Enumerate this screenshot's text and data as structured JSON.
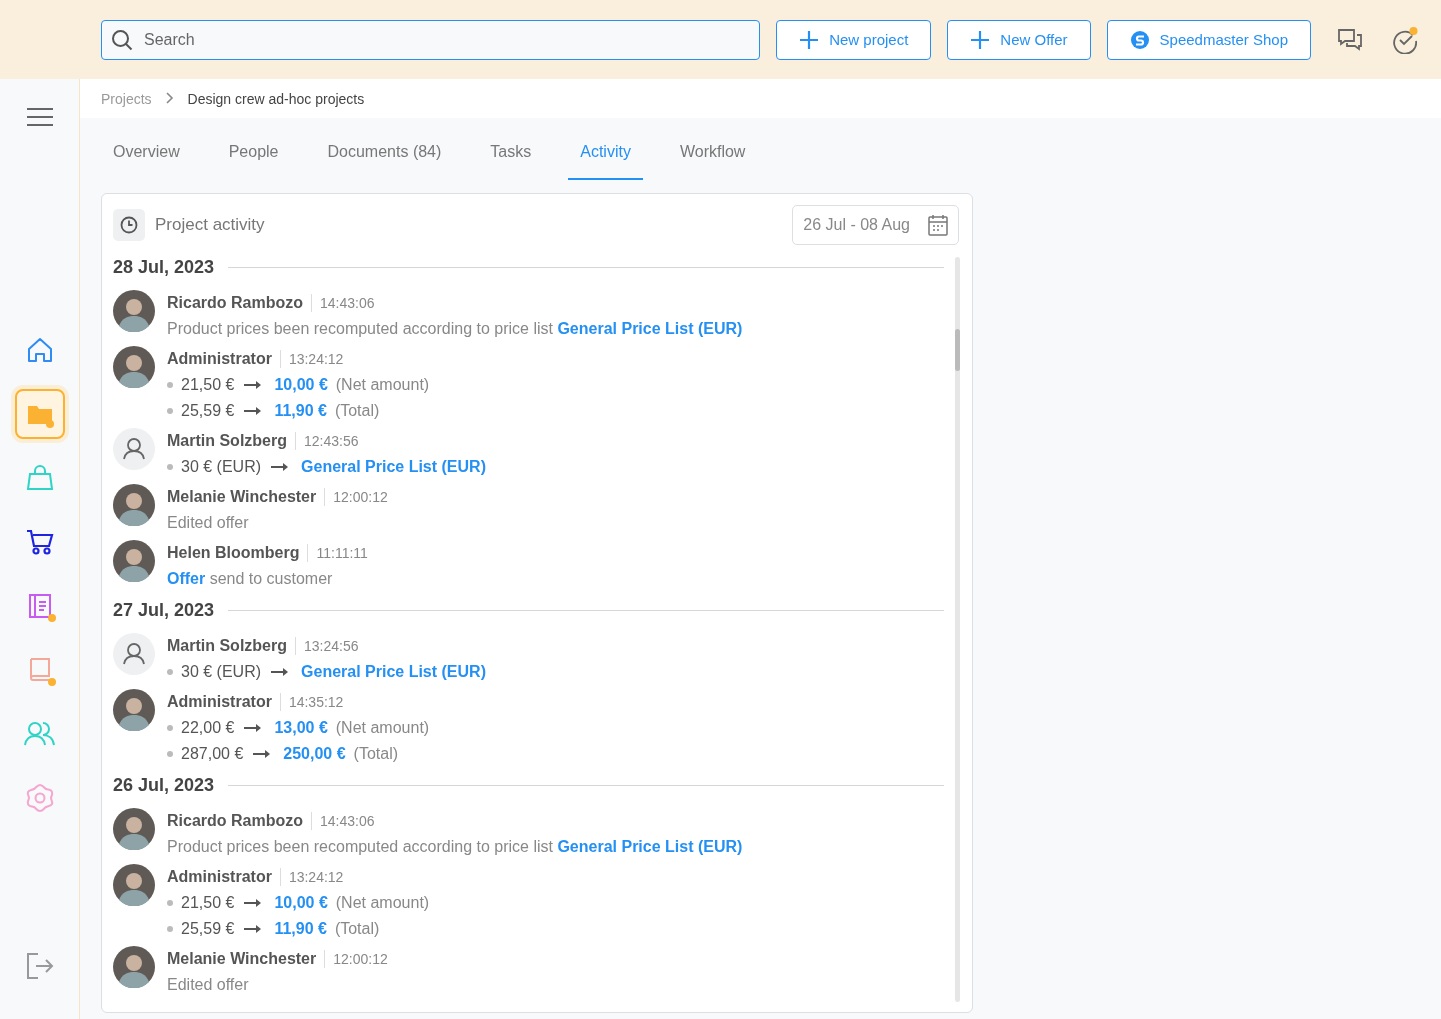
{
  "topbar": {
    "search": {
      "placeholder": "Search"
    },
    "buttons": [
      {
        "label": "New project",
        "kind": "plus"
      },
      {
        "label": "New Offer",
        "kind": "plus"
      },
      {
        "label": "Speedmaster Shop",
        "kind": "shop"
      }
    ],
    "notification_dot": true
  },
  "sidebar": {
    "items": [
      {
        "selected": false,
        "badge": false,
        "color": "#2f8cf5"
      },
      {
        "selected": true,
        "badge": true,
        "color": "#fbb131"
      },
      {
        "selected": false,
        "badge": false,
        "color": "#2fd4c6"
      },
      {
        "selected": false,
        "badge": false,
        "color": "#1f24e0"
      },
      {
        "selected": false,
        "badge": true,
        "color": "#c95cf0"
      },
      {
        "selected": false,
        "badge": true,
        "color": "#f3a89a"
      },
      {
        "selected": false,
        "badge": false,
        "color": "#2fd4c6"
      },
      {
        "selected": false,
        "badge": false,
        "color": "#f6a6cf"
      }
    ]
  },
  "breadcrumb": [
    "Projects",
    "Design crew ad-hoc projects"
  ],
  "tabs": [
    {
      "label": "Overview",
      "selected": false
    },
    {
      "label": "People",
      "selected": false
    },
    {
      "label": "Documents (84)",
      "selected": false
    },
    {
      "label": "Tasks",
      "selected": false
    },
    {
      "label": "Activity",
      "selected": true
    },
    {
      "label": "Workflow",
      "selected": false
    }
  ],
  "activity": {
    "title": "Project activity",
    "date_range": "26 Jul - 08 Aug",
    "days": [
      {
        "date": "28 Jul, 2023",
        "entries": [
          {
            "name": "Ricardo Rambozo",
            "time": "14:43:06",
            "kind": "photo",
            "lines": [
              {
                "kind": "message",
                "parts": [
                  {
                    "text": "Product prices been recomputed according to price list ",
                    "link": false
                  },
                  {
                    "text": "General Price List (EUR)",
                    "link": true
                  }
                ]
              }
            ]
          },
          {
            "name": "Administrator",
            "time": "13:24:12",
            "kind": "photo",
            "lines": [
              {
                "kind": "change",
                "from": "21,50 €",
                "to": "10,00 €",
                "note": "(Net amount)"
              },
              {
                "kind": "change",
                "from": "25,59 €",
                "to": "11,90 €",
                "note": "(Total)"
              }
            ]
          },
          {
            "name": "Martin Solzberg",
            "time": "12:43:56",
            "kind": "placeholder",
            "lines": [
              {
                "kind": "change",
                "from": "30 € (EUR)",
                "to": "General Price List (EUR)"
              }
            ]
          },
          {
            "name": "Melanie Winchester",
            "time": "12:00:12",
            "kind": "photo",
            "lines": [
              {
                "kind": "message",
                "parts": [
                  {
                    "text": "Edited offer",
                    "link": false
                  }
                ]
              }
            ]
          },
          {
            "name": "Helen Bloomberg",
            "time": "11:11:11",
            "kind": "photo",
            "lines": [
              {
                "kind": "message",
                "parts": [
                  {
                    "text": "Offer",
                    "link": true
                  },
                  {
                    "text": " send to customer",
                    "link": false
                  }
                ]
              }
            ]
          }
        ]
      },
      {
        "date": "27 Jul, 2023",
        "entries": [
          {
            "name": "Martin Solzberg",
            "time": "13:24:56",
            "kind": "placeholder",
            "lines": [
              {
                "kind": "change",
                "from": "30 € (EUR)",
                "to": "General Price List (EUR)"
              }
            ]
          },
          {
            "name": "Administrator",
            "time": "14:35:12",
            "kind": "photo",
            "lines": [
              {
                "kind": "change",
                "from": "22,00 €",
                "to": "13,00 €",
                "note": "(Net amount)"
              },
              {
                "kind": "change",
                "from": "287,00 €",
                "to": "250,00 €",
                "note": "(Total)"
              }
            ]
          }
        ]
      },
      {
        "date": "26 Jul, 2023",
        "entries": [
          {
            "name": "Ricardo Rambozo",
            "time": "14:43:06",
            "kind": "photo",
            "lines": [
              {
                "kind": "message",
                "parts": [
                  {
                    "text": "Product prices been recomputed according to price list ",
                    "link": false
                  },
                  {
                    "text": "General Price List (EUR)",
                    "link": true
                  }
                ]
              }
            ]
          },
          {
            "name": "Administrator",
            "time": "13:24:12",
            "kind": "photo",
            "lines": [
              {
                "kind": "change",
                "from": "21,50 €",
                "to": "10,00 €",
                "note": "(Net amount)"
              },
              {
                "kind": "change",
                "from": "25,59 €",
                "to": "11,90 €",
                "note": "(Total)"
              }
            ]
          },
          {
            "name": "Melanie Winchester",
            "time": "12:00:12",
            "kind": "photo",
            "lines": [
              {
                "kind": "message",
                "parts": [
                  {
                    "text": "Edited offer",
                    "link": false
                  }
                ]
              }
            ]
          }
        ]
      }
    ]
  }
}
